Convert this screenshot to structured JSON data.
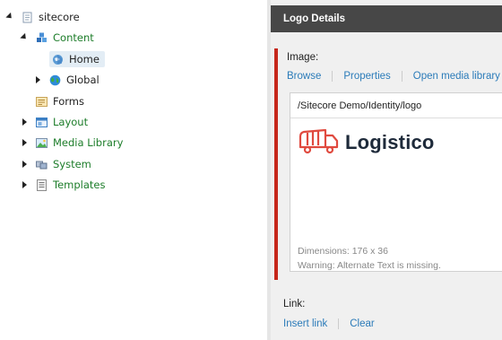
{
  "tree": {
    "items": [
      {
        "label": "sitecore",
        "icon": "tree-root-icon"
      },
      {
        "label": "Content",
        "icon": "content-cubes-icon"
      },
      {
        "label": "Home",
        "icon": "home-globe-icon"
      },
      {
        "label": "Global",
        "icon": "globe-icon"
      },
      {
        "label": "Forms",
        "icon": "forms-icon"
      },
      {
        "label": "Layout",
        "icon": "layout-icon"
      },
      {
        "label": "Media Library",
        "icon": "image-icon"
      },
      {
        "label": "System",
        "icon": "system-icon"
      },
      {
        "label": "Templates",
        "icon": "templates-icon"
      }
    ]
  },
  "editor": {
    "section_title": "Logo Details",
    "image_field": {
      "label": "Image:",
      "commands": [
        "Browse",
        "Properties",
        "Open media library"
      ],
      "path": "/Sitecore Demo/Identity/logo",
      "logo_text": "Logistico",
      "dimensions": "Dimensions: 176 x 36",
      "warning": "Warning: Alternate Text is missing."
    },
    "link_field": {
      "label": "Link:",
      "commands": [
        "Insert link",
        "Clear"
      ]
    }
  },
  "colors": {
    "accent_red": "#c6271b",
    "link_blue": "#2b7bb9",
    "tree_green": "#1d7d2a",
    "header_dark": "#474747"
  }
}
